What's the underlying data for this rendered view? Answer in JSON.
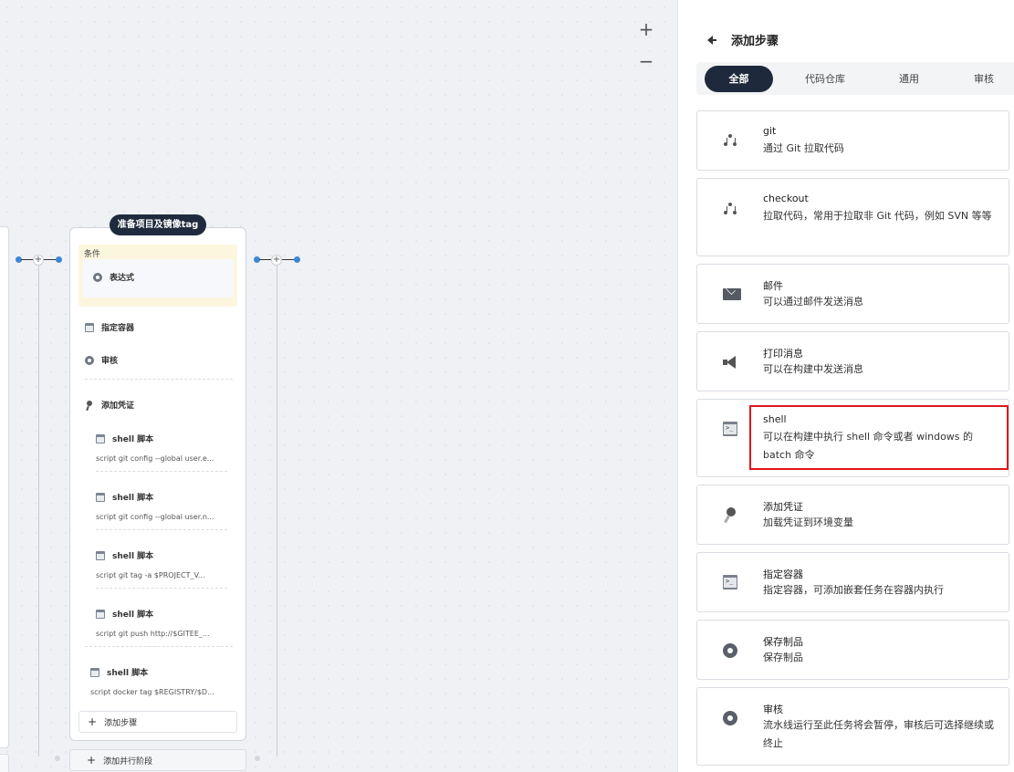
{
  "canvas": {
    "zoom_in_label": "+",
    "zoom_out_label": "−",
    "stage": {
      "title": "准备项目及镜像tag",
      "condition_label": "条件",
      "condition_step": "表达式",
      "steps": [
        {
          "label": "指定容器",
          "icon": "terminal-icon"
        },
        {
          "label": "审核",
          "icon": "circle-icon"
        },
        {
          "label": "添加凭证",
          "icon": "key-icon"
        }
      ],
      "shell_steps": [
        {
          "label": "shell 脚本",
          "script": "script   git config --global user.e..."
        },
        {
          "label": "shell 脚本",
          "script": "script   git config --global user.n..."
        },
        {
          "label": "shell 脚本",
          "script": "script   git tag -a $PROJECT_V..."
        },
        {
          "label": "shell 脚本",
          "script": "script   git push http://$GITEE_..."
        },
        {
          "label": "shell 脚本",
          "script": "script   docker tag $REGISTRY/$D..."
        }
      ],
      "add_step_label": "添加步骤"
    },
    "add_parallel_label": "添加并行阶段"
  },
  "panel": {
    "title": "添加步骤",
    "tabs": [
      {
        "label": "全部",
        "active": true
      },
      {
        "label": "代码仓库",
        "active": false
      },
      {
        "label": "通用",
        "active": false
      },
      {
        "label": "审核",
        "active": false
      }
    ],
    "cards": [
      {
        "name": "git",
        "desc": "通过 Git 拉取代码",
        "icon": "git-icon"
      },
      {
        "name": "checkout",
        "desc": "拉取代码，常用于拉取非 Git 代码，例如 SVN 等等",
        "icon": "git-icon"
      },
      {
        "name": "邮件",
        "desc": "可以通过邮件发送消息",
        "icon": "mail-icon"
      },
      {
        "name": "打印消息",
        "desc": "可以在构建中发送消息",
        "icon": "speaker-icon"
      },
      {
        "name": "shell",
        "desc": "可以在构建中执行 shell 命令或者 windows 的 batch 命令",
        "icon": "terminal-icon"
      },
      {
        "name": "添加凭证",
        "desc": "加载凭证到环境变量",
        "icon": "key-icon"
      },
      {
        "name": "指定容器",
        "desc": "指定容器，可添加嵌套任务在容器内执行",
        "icon": "terminal-icon"
      },
      {
        "name": "保存制品",
        "desc": "保存制品",
        "icon": "circle-icon"
      },
      {
        "name": "审核",
        "desc": "流水线运行至此任务将会暂停，审核后可选择继续或终止",
        "icon": "circle-icon"
      }
    ]
  },
  "colors": {
    "accent_dark": "#1e2a3c",
    "highlight": "#e0161b",
    "connector_dot": "#3d86d6",
    "condition_bg": "#fdf6de"
  }
}
